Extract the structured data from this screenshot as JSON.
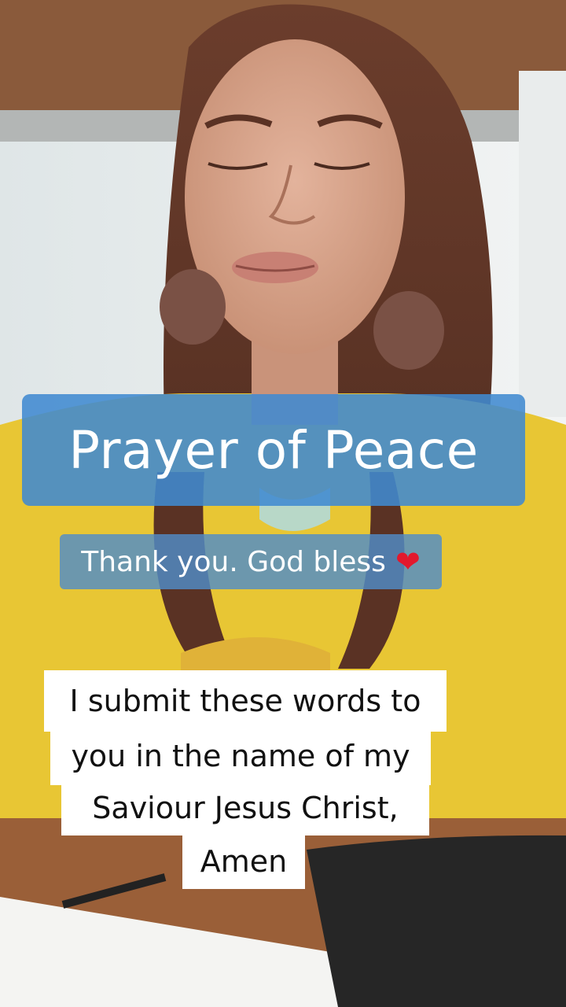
{
  "overlay": {
    "title": "Prayer of Peace",
    "subtitle": "Thank you. God bless",
    "subtitle_icon": "red-heart-icon",
    "prayer_lines": [
      "I submit these words to",
      "you in the name of my",
      "Saviour Jesus Christ,",
      "Amen"
    ]
  },
  "colors": {
    "title_bg": "#408ad0",
    "sweater_yellow": "#e8c634",
    "heart": "#e2182d",
    "text_box_bg": "#ffffff"
  }
}
